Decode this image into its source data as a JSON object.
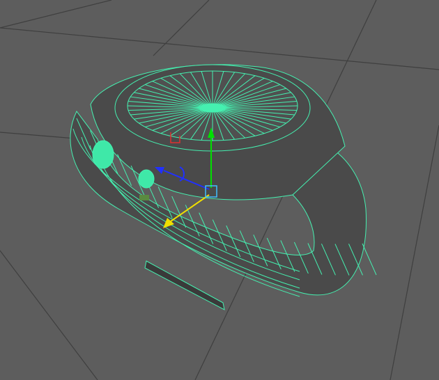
{
  "viewport": {
    "background_color": "#5d5d5d",
    "grid_color": "#3e3e3e",
    "wire_color": "#45f0b0",
    "mesh_color": "#4a4a4a",
    "icons": [
      "move-manipulator-icon",
      "rotate-handle-icon"
    ]
  },
  "manipulator": {
    "y_axis_color": "#00e000",
    "x_axis_color": "#2030ff",
    "z_axis_color": "#f0e000",
    "center_color": "#40c0ff",
    "pivot_color": "#e03030"
  }
}
